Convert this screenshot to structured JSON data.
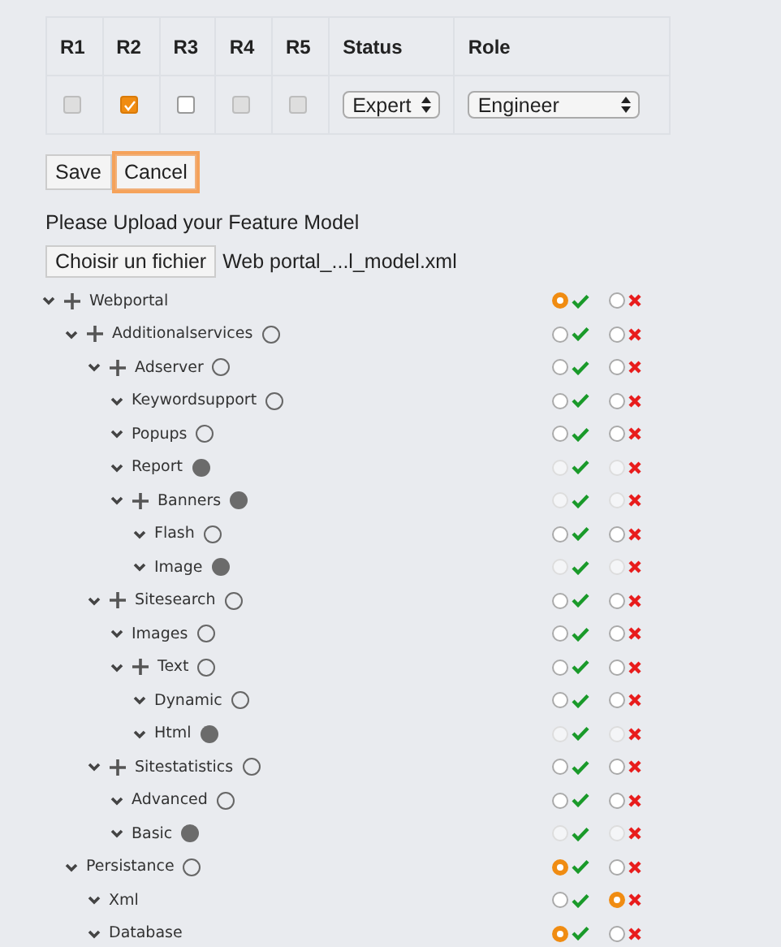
{
  "permissions": {
    "columns": [
      "R1",
      "R2",
      "R3",
      "R4",
      "R5",
      "Status",
      "Role"
    ],
    "checkboxes": [
      {
        "checked": false,
        "disabled": true
      },
      {
        "checked": true,
        "disabled": false
      },
      {
        "checked": false,
        "disabled": false
      },
      {
        "checked": false,
        "disabled": true
      },
      {
        "checked": false,
        "disabled": true
      }
    ],
    "status": "Expert",
    "role": "Engineer"
  },
  "buttons": [
    {
      "label": "Save",
      "focused": false
    },
    {
      "label": "Cancel",
      "focused": true
    }
  ],
  "upload": {
    "prompt": "Please Upload your Feature Model",
    "button": "Choisir un fichier",
    "file": "Web portal_...l_model.xml"
  },
  "tree": [
    {
      "name": "Webportal",
      "group": true,
      "accepted": true,
      "rejected": false,
      "disabled": false,
      "children": [
        {
          "name": "Additionalservices",
          "group": true,
          "kind": "optional",
          "accepted": false,
          "rejected": false,
          "disabled": false,
          "children": [
            {
              "name": "Adserver",
              "group": true,
              "kind": "optional",
              "accepted": false,
              "rejected": false,
              "disabled": false,
              "children": [
                {
                  "name": "Keywordsupport",
                  "group": false,
                  "kind": "optional",
                  "accepted": false,
                  "rejected": false,
                  "disabled": false
                },
                {
                  "name": "Popups",
                  "group": false,
                  "kind": "optional",
                  "accepted": false,
                  "rejected": false,
                  "disabled": false
                },
                {
                  "name": "Report",
                  "group": false,
                  "kind": "mandatory",
                  "accepted": false,
                  "rejected": false,
                  "disabled": true
                },
                {
                  "name": "Banners",
                  "group": true,
                  "kind": "mandatory",
                  "accepted": false,
                  "rejected": false,
                  "disabled": true,
                  "children": [
                    {
                      "name": "Flash",
                      "group": false,
                      "kind": "optional",
                      "accepted": false,
                      "rejected": false,
                      "disabled": false
                    },
                    {
                      "name": "Image",
                      "group": false,
                      "kind": "mandatory",
                      "accepted": false,
                      "rejected": false,
                      "disabled": true
                    }
                  ]
                }
              ]
            },
            {
              "name": "Sitesearch",
              "group": true,
              "kind": "optional",
              "accepted": false,
              "rejected": false,
              "disabled": false,
              "children": [
                {
                  "name": "Images",
                  "group": false,
                  "kind": "optional",
                  "accepted": false,
                  "rejected": false,
                  "disabled": false
                },
                {
                  "name": "Text",
                  "group": true,
                  "kind": "optional",
                  "accepted": false,
                  "rejected": false,
                  "disabled": false,
                  "children": [
                    {
                      "name": "Dynamic",
                      "group": false,
                      "kind": "optional",
                      "accepted": false,
                      "rejected": false,
                      "disabled": false
                    },
                    {
                      "name": "Html",
                      "group": false,
                      "kind": "mandatory",
                      "accepted": false,
                      "rejected": false,
                      "disabled": true
                    }
                  ]
                }
              ]
            },
            {
              "name": "Sitestatistics",
              "group": true,
              "kind": "optional",
              "accepted": false,
              "rejected": false,
              "disabled": false,
              "children": [
                {
                  "name": "Advanced",
                  "group": false,
                  "kind": "optional",
                  "accepted": false,
                  "rejected": false,
                  "disabled": false
                },
                {
                  "name": "Basic",
                  "group": false,
                  "kind": "mandatory",
                  "accepted": false,
                  "rejected": false,
                  "disabled": true
                }
              ]
            }
          ]
        },
        {
          "name": "Persistance",
          "group": false,
          "kind": "optional",
          "accepted": true,
          "rejected": false,
          "disabled": false,
          "children": [
            {
              "name": "Xml",
              "group": false,
              "accepted": false,
              "rejected": true,
              "disabled": false
            },
            {
              "name": "Database",
              "group": false,
              "accepted": true,
              "rejected": false,
              "disabled": false
            }
          ]
        }
      ]
    }
  ]
}
